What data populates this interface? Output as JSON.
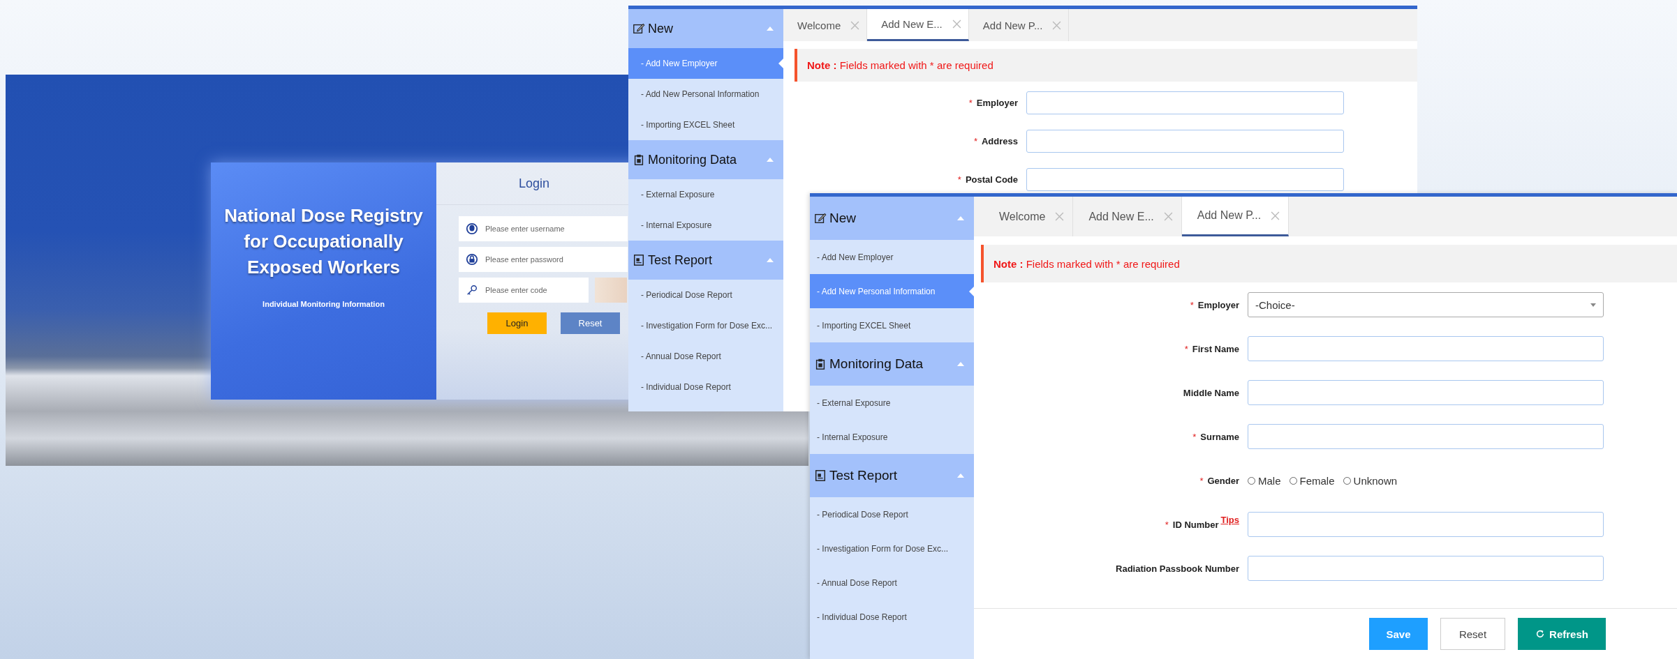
{
  "login": {
    "title": "National Dose Registry for Occupationally Exposed Workers",
    "subtitle": "Individual Monitoring Information",
    "heading": "Login",
    "fields": [
      {
        "kind": "user",
        "placeholder": "Please enter username"
      },
      {
        "kind": "password",
        "placeholder": "Please enter password"
      },
      {
        "kind": "code",
        "placeholder": "Please enter code"
      }
    ],
    "buttons": [
      {
        "kind": "primary",
        "label": "Login"
      },
      {
        "kind": "secondary",
        "label": "Reset"
      }
    ]
  },
  "windows": [
    {
      "sidebar": [
        {
          "kind": "edit",
          "title": "New",
          "expanded": true,
          "items": [
            {
              "label": "- Add New Employer",
              "selected": true
            },
            {
              "label": "- Add New Personal Information",
              "selected": false
            },
            {
              "label": "- Importing EXCEL Sheet",
              "selected": false
            }
          ]
        },
        {
          "kind": "clipboard",
          "title": "Monitoring Data",
          "expanded": true,
          "items": [
            {
              "label": "- External Exposure",
              "selected": false
            },
            {
              "label": "- Internal Exposure",
              "selected": false
            }
          ]
        },
        {
          "kind": "report",
          "title": "Test Report",
          "expanded": true,
          "items": [
            {
              "label": "- Periodical Dose Report",
              "selected": false
            },
            {
              "label": "- Investigation Form for Dose Exc...",
              "selected": false
            },
            {
              "label": "- Annual Dose Report",
              "selected": false
            },
            {
              "label": "- Individual Dose Report",
              "selected": false
            }
          ]
        }
      ],
      "tabs": [
        {
          "label": "Welcome",
          "selected": false
        },
        {
          "label": "Add New E...",
          "selected": true
        },
        {
          "label": "Add New P...",
          "selected": false
        }
      ],
      "note": {
        "label": "Note :",
        "text": "Fields marked with * are required"
      },
      "form": [
        {
          "kind": "text",
          "label": "Employer",
          "marker": "*"
        },
        {
          "kind": "text",
          "label": "Address",
          "marker": "*"
        },
        {
          "kind": "text",
          "label": "Postal Code",
          "marker": "*"
        }
      ]
    },
    {
      "sidebar": [
        {
          "kind": "edit",
          "title": "New",
          "expanded": true,
          "items": [
            {
              "label": "- Add New Employer",
              "selected": false
            },
            {
              "label": "- Add New Personal Information",
              "selected": true
            },
            {
              "label": "- Importing EXCEL Sheet",
              "selected": false
            }
          ]
        },
        {
          "kind": "clipboard",
          "title": "Monitoring Data",
          "expanded": true,
          "items": [
            {
              "label": "- External Exposure",
              "selected": false
            },
            {
              "label": "- Internal Exposure",
              "selected": false
            }
          ]
        },
        {
          "kind": "report",
          "title": "Test Report",
          "expanded": true,
          "items": [
            {
              "label": "- Periodical Dose Report",
              "selected": false
            },
            {
              "label": "- Investigation Form for Dose Exc...",
              "selected": false
            },
            {
              "label": "- Annual Dose Report",
              "selected": false
            },
            {
              "label": "- Individual Dose Report",
              "selected": false
            }
          ]
        }
      ],
      "tabs": [
        {
          "label": "Welcome",
          "selected": false
        },
        {
          "label": "Add New E...",
          "selected": false
        },
        {
          "label": "Add New P...",
          "selected": true
        }
      ],
      "note": {
        "label": "Note :",
        "text": "Fields marked with * are required"
      },
      "form": [
        {
          "kind": "select",
          "label": "Employer",
          "marker": "*",
          "value": "-Choice-"
        },
        {
          "kind": "text",
          "label": "First Name",
          "marker": "*"
        },
        {
          "kind": "text",
          "label": "Middle Name"
        },
        {
          "kind": "text",
          "label": "Surname",
          "marker": "*"
        },
        {
          "kind": "radio",
          "label": "Gender",
          "marker": "*",
          "options": [
            {
              "label": "Male",
              "selected": false
            },
            {
              "label": "Female",
              "selected": false
            },
            {
              "label": "Unknown",
              "selected": false
            }
          ]
        },
        {
          "kind": "text",
          "label": "ID Number",
          "marker": "*",
          "tip": "Tips"
        },
        {
          "kind": "text",
          "label": "Radiation Passbook Number"
        }
      ],
      "footer_buttons": [
        {
          "kind": "primary",
          "label": "Save"
        },
        {
          "kind": "plain",
          "label": "Reset"
        },
        {
          "kind": "success",
          "label": "Refresh"
        }
      ]
    }
  ]
}
